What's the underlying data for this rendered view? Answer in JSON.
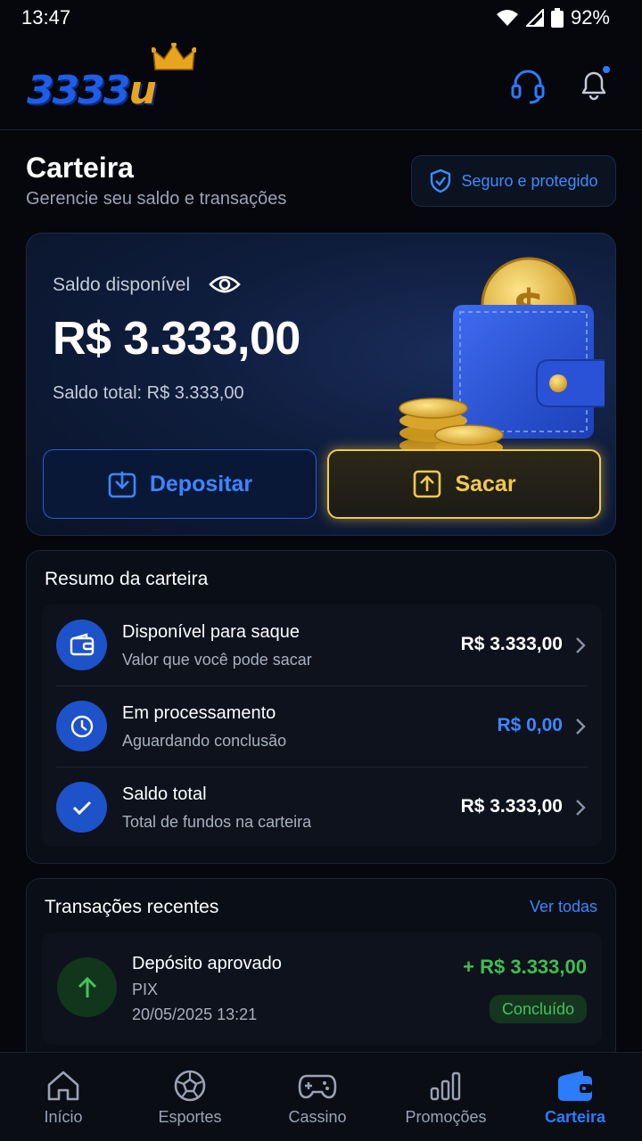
{
  "status_bar": {
    "time": "13:47",
    "battery": "92%"
  },
  "header": {
    "logo_text": "3333",
    "logo_u": "u",
    "support_icon": "headset-icon",
    "notifications_icon": "bell-icon"
  },
  "page": {
    "title": "Carteira",
    "subtitle": "Gerencie seu saldo e transações",
    "secure_label": "Seguro e protegido"
  },
  "balance": {
    "label": "Saldo disponível",
    "value": "R$ 3.333,00",
    "total": "Saldo total: R$ 3.333,00",
    "deposit_label": "Depositar",
    "withdraw_label": "Sacar"
  },
  "summary": {
    "title": "Resumo da carteira",
    "rows": [
      {
        "title": "Disponível para saque",
        "subtitle": "Valor que você pode sacar",
        "value": "R$ 3.333,00",
        "icon": "wallet-icon"
      },
      {
        "title": "Em processamento",
        "subtitle": "Aguardando conclusão",
        "value": "R$ 0,00",
        "icon": "clock-icon"
      },
      {
        "title": "Saldo total",
        "subtitle": "Total de fundos na carteira",
        "value": "R$ 3.333,00",
        "icon": "check-icon"
      }
    ]
  },
  "transactions": {
    "title": "Transações recentes",
    "see_all": "Ver todas",
    "items": [
      {
        "name": "Depósito aprovado",
        "method": "PIX",
        "date": "20/05/2025 13:21",
        "amount": "+ R$ 3.333,00",
        "status": "Concluído"
      }
    ]
  },
  "nav": {
    "items": [
      {
        "label": "Início",
        "icon": "home-icon"
      },
      {
        "label": "Esportes",
        "icon": "soccer-ball-icon"
      },
      {
        "label": "Cassino",
        "icon": "gamepad-icon"
      },
      {
        "label": "Promoções",
        "icon": "bar-chart-icon"
      },
      {
        "label": "Carteira",
        "icon": "wallet-icon"
      }
    ],
    "active": "Carteira"
  },
  "colors": {
    "accent": "#2d7bff",
    "gold": "#f2c94c",
    "success": "#3fbf4f",
    "background": "#05070c"
  }
}
